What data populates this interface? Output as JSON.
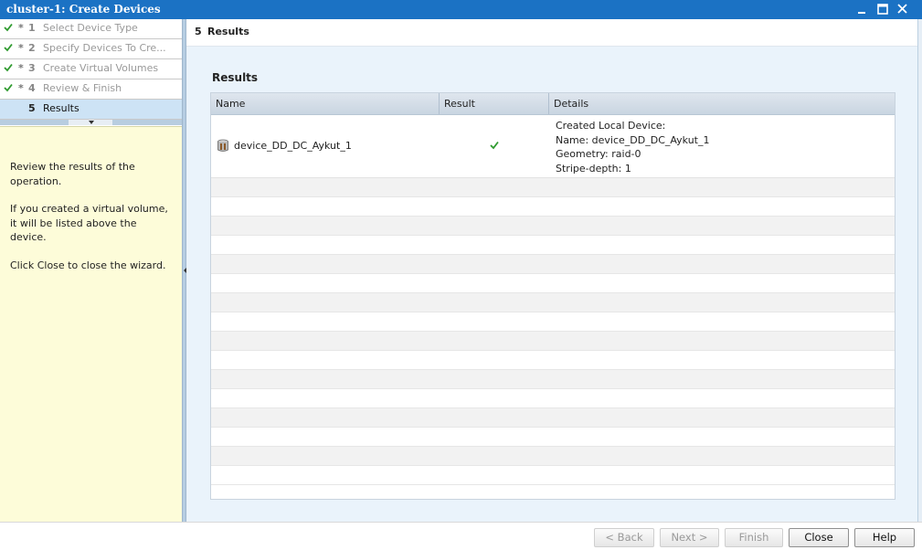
{
  "window": {
    "title": "cluster-1: Create Devices"
  },
  "steps": [
    {
      "star": "*",
      "num": "1",
      "label": "Select Device Type",
      "done": true
    },
    {
      "star": "*",
      "num": "2",
      "label": "Specify Devices To Cre...",
      "done": true
    },
    {
      "star": "*",
      "num": "3",
      "label": "Create Virtual Volumes",
      "done": true
    },
    {
      "star": "*",
      "num": "4",
      "label": "Review & Finish",
      "done": true
    },
    {
      "star": "",
      "num": "5",
      "label": "Results",
      "done": false,
      "active": true
    }
  ],
  "help": {
    "p1": "Review the results of the operation.",
    "p2": "If you created a virtual volume, it will be listed above the device.",
    "p3": "Click Close to close the wizard."
  },
  "page": {
    "num": "5",
    "title": "Results"
  },
  "results": {
    "section_title": "Results",
    "columns": [
      "Name",
      "Result",
      "Details"
    ],
    "rows": [
      {
        "name": "device_DD_DC_Aykut_1",
        "result": "success",
        "details": [
          "Created Local Device:",
          "Name: device_DD_DC_Aykut_1",
          "Geometry: raid-0",
          "Stripe-depth: 1"
        ]
      }
    ]
  },
  "footer": {
    "back": "< Back",
    "next": "Next >",
    "finish": "Finish",
    "close": "Close",
    "help": "Help"
  },
  "colors": {
    "titlebar": "#1b72c4",
    "active_step": "#cde3f5",
    "help_bg": "#fdfcd9",
    "check_green": "#2e9a2e"
  }
}
